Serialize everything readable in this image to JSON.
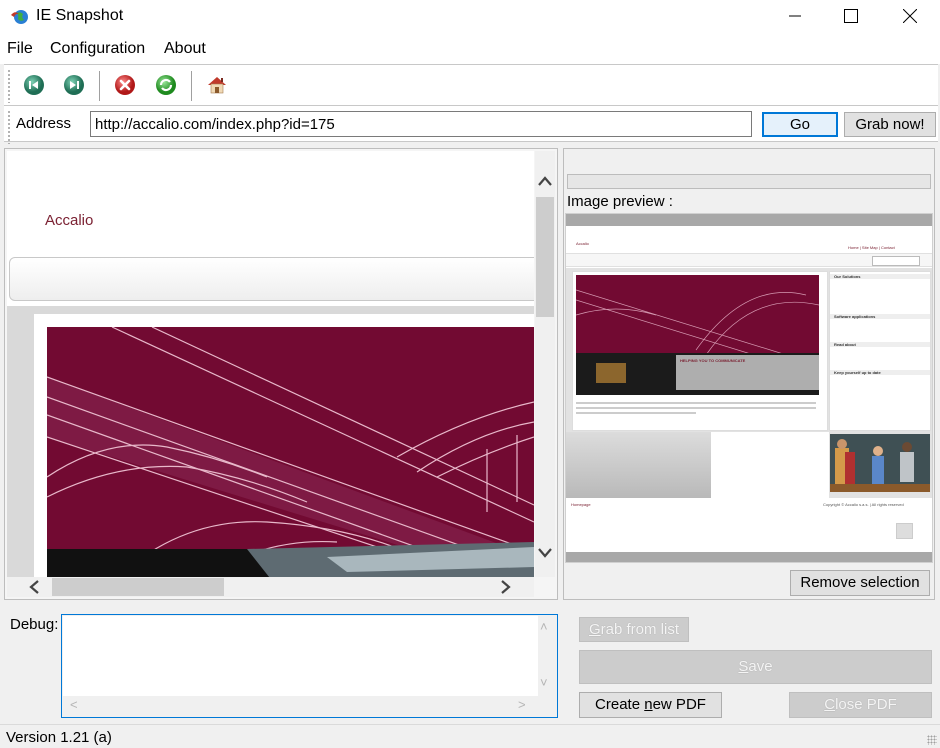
{
  "window": {
    "title": "IE Snapshot",
    "minimize_glyph": "—",
    "maximize_glyph": "☐",
    "close_glyph": "✕"
  },
  "menu": [
    "File",
    "Configuration",
    "About"
  ],
  "toolbar": {
    "buttons": [
      {
        "name": "back",
        "icon": "back-arrow-icon",
        "color": "#2e8b6a"
      },
      {
        "name": "forward",
        "icon": "forward-arrow-icon",
        "color": "#2e8b6a"
      },
      {
        "name": "stop",
        "icon": "stop-icon",
        "color": "#d42a2a"
      },
      {
        "name": "refresh",
        "icon": "refresh-icon",
        "color": "#2ea82e"
      },
      {
        "name": "home",
        "icon": "home-icon",
        "color": "#c0392b"
      }
    ]
  },
  "address": {
    "label": "Address",
    "value": "http://accalio.com/index.php?id=175",
    "go_label": "Go",
    "grab_now_label": "Grab now!"
  },
  "browser": {
    "site_logo": "Accalio",
    "hero_color": "#720a32",
    "scroll_up": "^",
    "scroll_down": "v",
    "scroll_left": "<",
    "scroll_right": ">"
  },
  "preview": {
    "label": "Image preview :",
    "site_logo": "Accalio",
    "top_links": "Home | Site Map | Contact",
    "hero_heading": "HELPING YOU TO COMMUNICATE",
    "sidebar_sections": [
      "Our Solutions",
      "Software applications",
      "Read about",
      "Keep yourself up to date"
    ],
    "footer_left": "Homepage",
    "footer_copyright": "Copyright © Accalio s.a.s. | All rights reserved",
    "remove_selection_label": "Remove selection"
  },
  "debug": {
    "label": "Debug:",
    "value": ""
  },
  "actions": {
    "grab_from_list": {
      "pre": "",
      "u": "G",
      "post": "rab from list"
    },
    "save": {
      "pre": "",
      "u": "S",
      "post": "ave"
    },
    "create_pdf": {
      "pre": "Create ",
      "u": "n",
      "post": "ew PDF"
    },
    "close_pdf": {
      "pre": "",
      "u": "C",
      "post": "lose PDF"
    }
  },
  "status": {
    "version": "Version 1.21 (a)"
  }
}
